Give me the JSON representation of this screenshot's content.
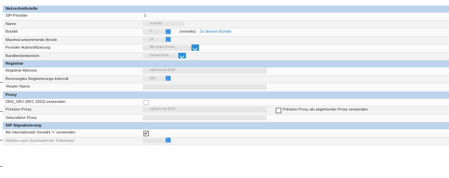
{
  "sections": {
    "netz": {
      "title": "Netzschnittstelle",
      "sip_provider": {
        "label": "SIP-Provider",
        "value": "1"
      },
      "name": {
        "label": "Name",
        "value": "reventix"
      },
      "buendel": {
        "label": "Bündel",
        "value": "6",
        "suffix": "(reventix)",
        "link": "Zu diesem Bündel"
      },
      "max_calls": {
        "label": "Maximal ankommende Anrufe",
        "value": "10"
      },
      "auth": {
        "label": "Provider-Authentifizierung",
        "value": "Mit einem Konto"
      },
      "band": {
        "label": "Bandbreitenbereich",
        "value": "Default Area"
      }
    },
    "registrar": {
      "title": "Registrar",
      "address": {
        "label": "Registrar-Adresse",
        "value": "sipbase.de:5060"
      },
      "interval": {
        "label": "Bevorzugtes Registrierungs-Intervall",
        "value": "600"
      },
      "realm": {
        "label": "'Realm'-Name",
        "value": ""
      }
    },
    "proxy": {
      "title": "Proxy",
      "dns": {
        "label": "DNS_SRV (RFC 3263) verwenden"
      },
      "primary": {
        "label": "Primärer Proxy",
        "value": "sipbase.de:5060",
        "checkbox_label": "Primärer Proxy als abgehender Proxy verwenden"
      },
      "secondary": {
        "label": "Sekundärer Proxy",
        "value": ""
      }
    },
    "sip": {
      "title": "SIP-Signalisierung",
      "intl_prefix": {
        "label": "Als internationale Vorwahl '+' verwenden",
        "checked": true
      },
      "cut_label": "Wählen nach Durchwahl der Teilnehmer"
    }
  },
  "colors": {
    "header_bg": "#bcd4ec",
    "accent": "#2b8fd8",
    "link": "#2a8bd2"
  }
}
